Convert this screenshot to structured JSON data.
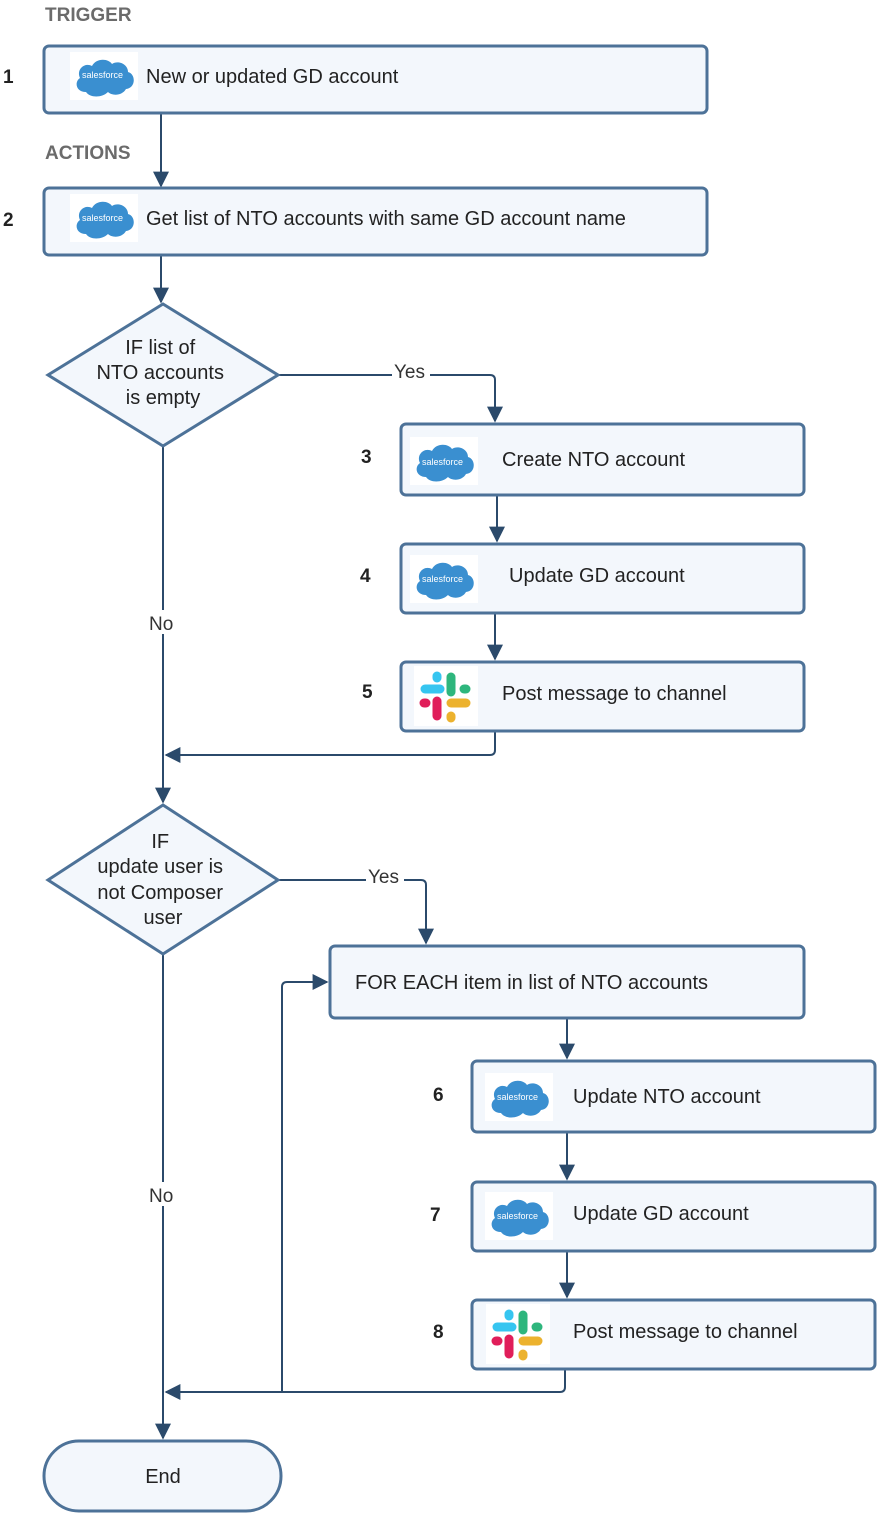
{
  "sections": {
    "trigger": "TRIGGER",
    "actions": "ACTIONS"
  },
  "steps": [
    {
      "number": "1",
      "label": "New or updated GD account",
      "icon": "salesforce-icon"
    },
    {
      "number": "2",
      "label": "Get list of NTO accounts with same GD account name",
      "icon": "salesforce-icon"
    },
    {
      "number": "3",
      "label": "Create NTO account",
      "icon": "salesforce-icon"
    },
    {
      "number": "4",
      "label": "Update GD account",
      "icon": "salesforce-icon"
    },
    {
      "number": "5",
      "label": "Post message to channel",
      "icon": "slack-icon"
    },
    {
      "number": "6",
      "label": "Update NTO account",
      "icon": "salesforce-icon"
    },
    {
      "number": "7",
      "label": "Update GD account",
      "icon": "salesforce-icon"
    },
    {
      "number": "8",
      "label": "Post message to channel",
      "icon": "slack-icon"
    }
  ],
  "decisions": [
    {
      "lines": [
        "IF list of",
        "NTO accounts",
        "is empty"
      ],
      "yes": "Yes",
      "no": "No"
    },
    {
      "lines": [
        "IF",
        "update user is",
        "not Composer",
        "user"
      ],
      "yes": "Yes",
      "no": "No"
    }
  ],
  "loop": {
    "label": "FOR EACH item in list of NTO accounts"
  },
  "end": {
    "label": "End"
  },
  "logo_text": "salesforce",
  "colors": {
    "box_fill": "#f3f7fc",
    "box_border": "#4d7298",
    "connector": "#2b4a6b",
    "salesforce_blue": "#3a8fd0"
  }
}
